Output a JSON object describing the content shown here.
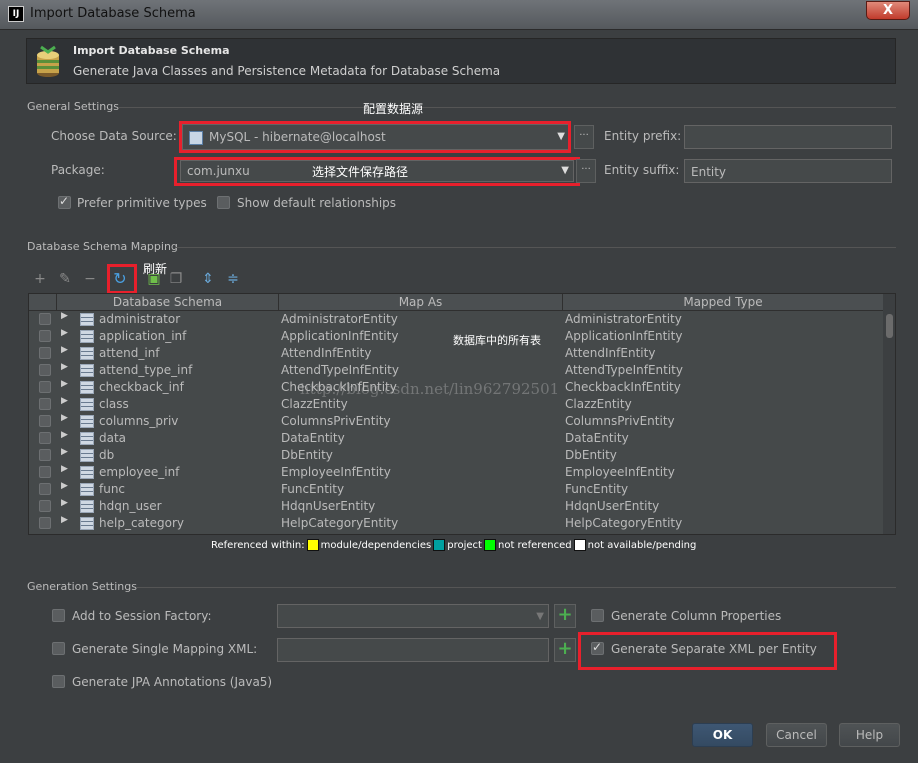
{
  "window": {
    "title": "Import Database Schema",
    "close_label": "X"
  },
  "header": {
    "title": "Import Database Schema",
    "subtitle": "Generate Java Classes and Persistence Metadata for Database Schema"
  },
  "general": {
    "section_title": "General Settings",
    "data_source_label": "Choose Data Source:",
    "data_source_value": "MySQL - hibernate@localhost",
    "package_label": "Package:",
    "package_value": "com.junxu",
    "entity_prefix_label": "Entity prefix:",
    "entity_prefix_value": "",
    "entity_suffix_label": "Entity suffix:",
    "entity_suffix_value": "Entity",
    "prefer_primitive_label": "Prefer primitive types",
    "prefer_primitive_checked": true,
    "show_default_rel_label": "Show default relationships",
    "show_default_rel_checked": false
  },
  "annotations": {
    "config_ds": "配置数据源",
    "save_path": "选择文件保存路径",
    "refresh": "刷新",
    "all_tables": "数据库中的所有表"
  },
  "mapping": {
    "section_title": "Database Schema Mapping",
    "columns": [
      "Database Schema",
      "Map As",
      "Mapped Type"
    ],
    "rows": [
      {
        "schema": "administrator",
        "map_as": "AdministratorEntity",
        "mapped_type": "AdministratorEntity"
      },
      {
        "schema": "application_inf",
        "map_as": "ApplicationInfEntity",
        "mapped_type": "ApplicationInfEntity"
      },
      {
        "schema": "attend_inf",
        "map_as": "AttendInfEntity",
        "mapped_type": "AttendInfEntity"
      },
      {
        "schema": "attend_type_inf",
        "map_as": "AttendTypeInfEntity",
        "mapped_type": "AttendTypeInfEntity"
      },
      {
        "schema": "checkback_inf",
        "map_as": "CheckbackInfEntity",
        "mapped_type": "CheckbackInfEntity"
      },
      {
        "schema": "class",
        "map_as": "ClazzEntity",
        "mapped_type": "ClazzEntity"
      },
      {
        "schema": "columns_priv",
        "map_as": "ColumnsPrivEntity",
        "mapped_type": "ColumnsPrivEntity"
      },
      {
        "schema": "data",
        "map_as": "DataEntity",
        "mapped_type": "DataEntity"
      },
      {
        "schema": "db",
        "map_as": "DbEntity",
        "mapped_type": "DbEntity"
      },
      {
        "schema": "employee_inf",
        "map_as": "EmployeeInfEntity",
        "mapped_type": "EmployeeInfEntity"
      },
      {
        "schema": "func",
        "map_as": "FuncEntity",
        "mapped_type": "FuncEntity"
      },
      {
        "schema": "hdqn_user",
        "map_as": "HdqnUserEntity",
        "mapped_type": "HdqnUserEntity"
      },
      {
        "schema": "help_category",
        "map_as": "HelpCategoryEntity",
        "mapped_type": "HelpCategoryEntity"
      }
    ],
    "watermark": "http://blog.csdn.net/lin962792501",
    "legend": {
      "prefix": "Referenced within:",
      "items": [
        {
          "label": "module/dependencies",
          "color": "#ffff00"
        },
        {
          "label": "project",
          "color": "#00a0a0"
        },
        {
          "label": "not referenced",
          "color": "#00ff00"
        },
        {
          "label": "not available/pending",
          "color": "#ffffff"
        }
      ]
    }
  },
  "generation": {
    "section_title": "Generation Settings",
    "add_session_label": "Add to Session Factory:",
    "single_mapping_label": "Generate Single Mapping XML:",
    "jpa_label": "Generate JPA Annotations (Java5)",
    "column_props_label": "Generate Column Properties",
    "separate_xml_label": "Generate Separate XML per Entity",
    "separate_xml_checked": true
  },
  "buttons": {
    "ok": "OK",
    "cancel": "Cancel",
    "help": "Help"
  }
}
